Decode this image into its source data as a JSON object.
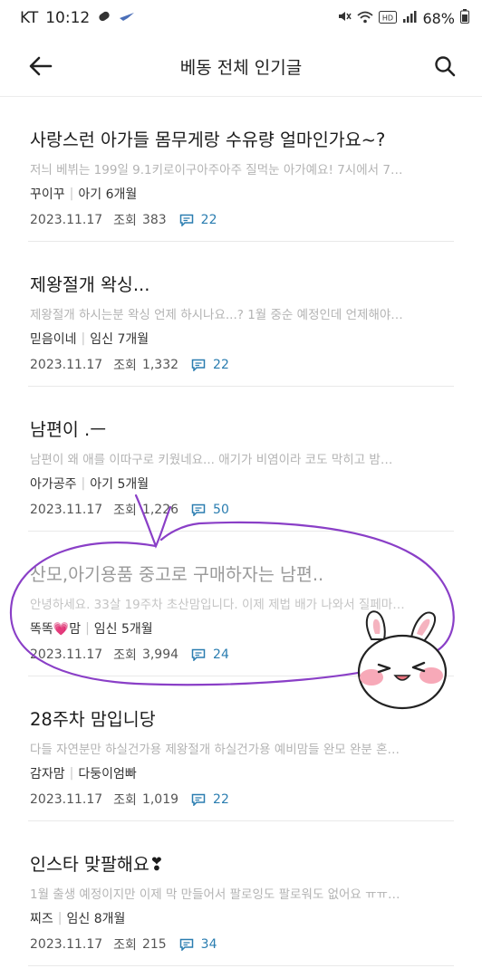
{
  "status_bar": {
    "carrier": "KT",
    "time": "10:12",
    "battery": "68%",
    "icons": [
      "badge-icon",
      "plane-icon",
      "mute-icon",
      "wifi-icon",
      "hd-icon",
      "signal-icon",
      "battery-icon"
    ]
  },
  "header": {
    "title": "베동 전체 인기글",
    "back_icon": "back-arrow-icon",
    "search_icon": "search-icon"
  },
  "colors": {
    "comment": "#2a7db0",
    "preview": "#b3b3b3",
    "annotation": "#8a3fc7"
  },
  "posts": [
    {
      "title": "사랑스런 아가들 몸무게랑 수유량 얼마인가요~?",
      "preview": "저늬 베뷔는 199일 9.1키로이구아주아주 질먹눈 아가예요! 7시에서 7…",
      "author": "꾸이꾸",
      "stage": "아기 6개월",
      "date": "2023.11.17",
      "views_label": "조회",
      "views": "383",
      "comments": "22"
    },
    {
      "title": "제왕절개 왁싱...",
      "preview": "제왕절개 하시는분 왁싱 언제 하시나요...? 1월 중순 예정인데 언제해야…",
      "author": "믿음이네",
      "stage": "임신 7개월",
      "date": "2023.11.17",
      "views_label": "조회",
      "views": "1,332",
      "comments": "22"
    },
    {
      "title": "남편이 .ㅡ",
      "preview": "남편이 왜 애를 이따구로 키웠네요...  애기가 비염이라 코도 막히고 밤…",
      "author": "아가공주",
      "stage": "아기 5개월",
      "date": "2023.11.17",
      "views_label": "조회",
      "views": "1,226",
      "comments": "50"
    },
    {
      "title": "산모,아기용품 중고로 구매하자는 남편..",
      "preview": "안녕하세요. 33살 19주차 초산맘입니다. 이제 제법 배가 나와서 질페마…",
      "author": "똑똑💗맘",
      "stage": "임신 5개월",
      "date": "2023.11.17",
      "views_label": "조회",
      "views": "3,994",
      "comments": "24"
    },
    {
      "title": "28주차 맘입니당",
      "preview": "다들 자연분만 하실건가용 제왕절개 하실건가용 예비맘들 완모 완분 혼…",
      "author": "감자맘",
      "stage": "다둥이엄빠",
      "date": "2023.11.17",
      "views_label": "조회",
      "views": "1,019",
      "comments": "22"
    },
    {
      "title": "인스타 맞팔해요❣",
      "preview": "1월 출생 예정이지만 이제 막 만들어서 팔로잉도 팔로워도 없어요 ㅠㅠ…",
      "author": "찌즈",
      "stage": "임신 8개월",
      "date": "2023.11.17",
      "views_label": "조회",
      "views": "215",
      "comments": "34"
    }
  ]
}
